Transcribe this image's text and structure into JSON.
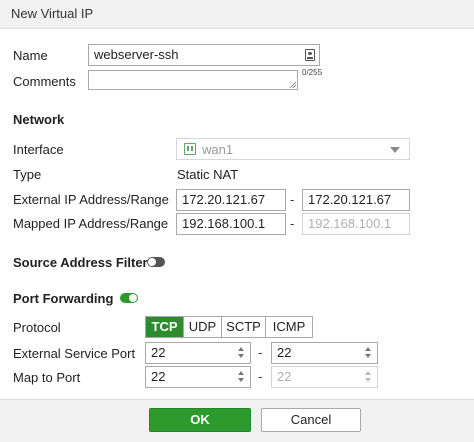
{
  "dialog": {
    "title": "New Virtual IP"
  },
  "form": {
    "name_label": "Name",
    "name_value": "webserver-ssh",
    "comments_label": "Comments",
    "comments_value": "",
    "comments_counter": "0/255",
    "network_heading": "Network",
    "interface_label": "Interface",
    "interface_value": "wan1",
    "type_label": "Type",
    "type_value": "Static NAT",
    "ext_ip_label": "External IP Address/Range",
    "ext_ip_start": "172.20.121.67",
    "ext_ip_end": "172.20.121.67",
    "mapped_ip_label": "Mapped IP Address/Range",
    "mapped_ip_start": "192.168.100.1",
    "mapped_ip_end": "192.168.100.1",
    "range_separator": "-",
    "source_filter_label": "Source Address Filter",
    "source_filter_on": false,
    "port_forwarding_label": "Port Forwarding",
    "port_forwarding_on": true,
    "protocol_label": "Protocol",
    "protocol_options": [
      "TCP",
      "UDP",
      "SCTP",
      "ICMP"
    ],
    "protocol_selected": "TCP",
    "ext_port_label": "External Service Port",
    "ext_port_start": "22",
    "ext_port_end": "22",
    "map_port_label": "Map to Port",
    "map_port_start": "22",
    "map_port_end": "22"
  },
  "footer": {
    "ok_label": "OK",
    "cancel_label": "Cancel"
  },
  "colors": {
    "accent": "#2d9a2d",
    "toggle_off": "#555555"
  },
  "icons": {
    "name_field": "id-card-icon",
    "interface": "network-port-icon",
    "dropdown": "chevron-down-icon",
    "spinner": "spinner-arrows-icon"
  }
}
